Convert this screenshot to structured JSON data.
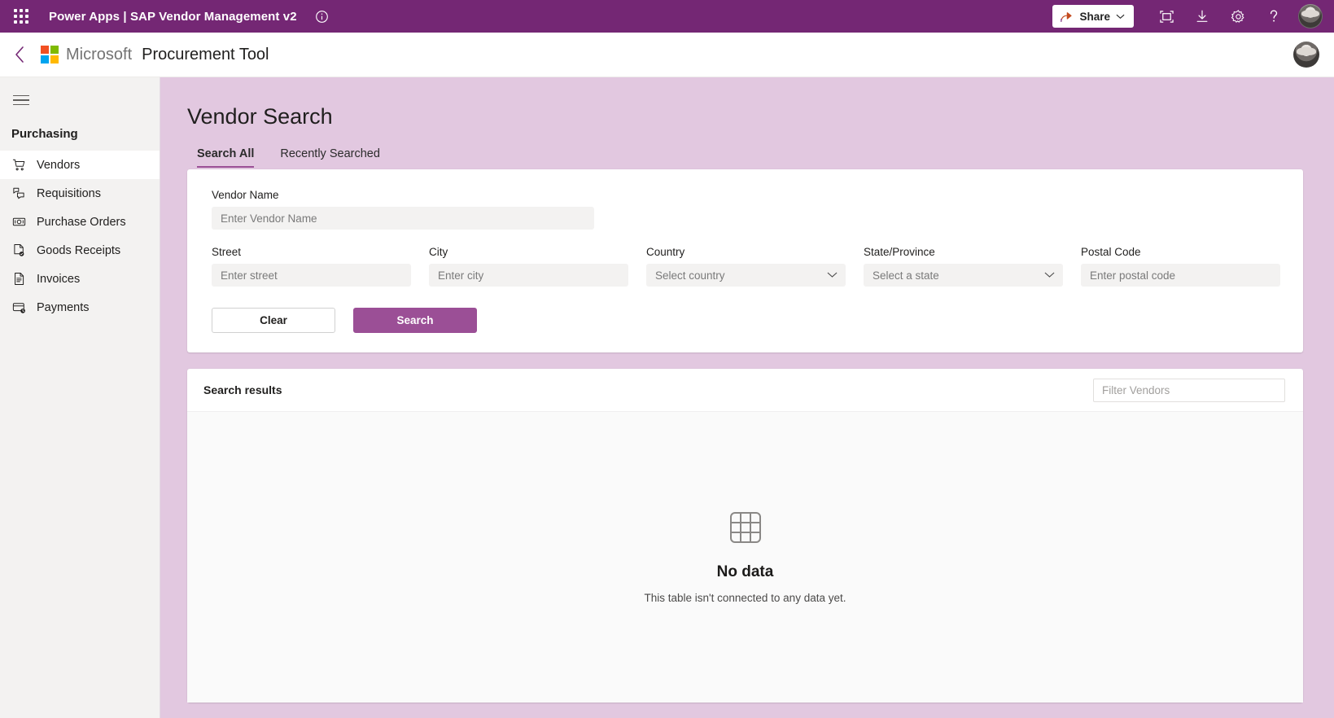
{
  "topbar": {
    "waffle_label": "App launcher",
    "title": "Power Apps  |  SAP Vendor Management v2",
    "info_label": "Information",
    "share_label": "Share",
    "present_label": "Present",
    "download_label": "Download",
    "settings_label": "Settings",
    "help_label": "Help",
    "account_label": "Account manager",
    "background": "#742774"
  },
  "appbar": {
    "back_label": "Back",
    "brand": "Microsoft",
    "tool_name": "Procurement Tool",
    "accent": "#9b4f96"
  },
  "sidebar": {
    "menu_label": "Collapse navigation",
    "section_title": "Purchasing",
    "items": [
      {
        "label": "Vendors",
        "icon": "shopping-cart-icon",
        "active": true
      },
      {
        "label": "Requisitions",
        "icon": "requisition-icon",
        "active": false
      },
      {
        "label": "Purchase Orders",
        "icon": "money-icon",
        "active": false
      },
      {
        "label": "Goods Receipts",
        "icon": "receipt-check-icon",
        "active": false
      },
      {
        "label": "Invoices",
        "icon": "invoice-document-icon",
        "active": false
      },
      {
        "label": "Payments",
        "icon": "payment-card-clock-icon",
        "active": false
      }
    ]
  },
  "page": {
    "title": "Vendor Search",
    "tabs": [
      {
        "label": "Search All",
        "active": true
      },
      {
        "label": "Recently Searched",
        "active": false
      }
    ]
  },
  "search_form": {
    "vendor_name": {
      "label": "Vendor Name",
      "placeholder": "Enter Vendor Name",
      "value": ""
    },
    "street": {
      "label": "Street",
      "placeholder": "Enter street",
      "value": ""
    },
    "city": {
      "label": "City",
      "placeholder": "Enter city",
      "value": ""
    },
    "country": {
      "label": "Country",
      "placeholder": "Select country",
      "value": ""
    },
    "state": {
      "label": "State/Province",
      "placeholder": "Select a state",
      "value": ""
    },
    "postal_code": {
      "label": "Postal Code",
      "placeholder": "Enter postal code",
      "value": ""
    },
    "clear_label": "Clear",
    "search_label": "Search"
  },
  "results": {
    "title": "Search results",
    "filter_placeholder": "Filter Vendors",
    "filter_value": "",
    "empty_icon": "table-grid-icon",
    "empty_title": "No data",
    "empty_subtitle": "This table isn't connected to any data yet."
  }
}
